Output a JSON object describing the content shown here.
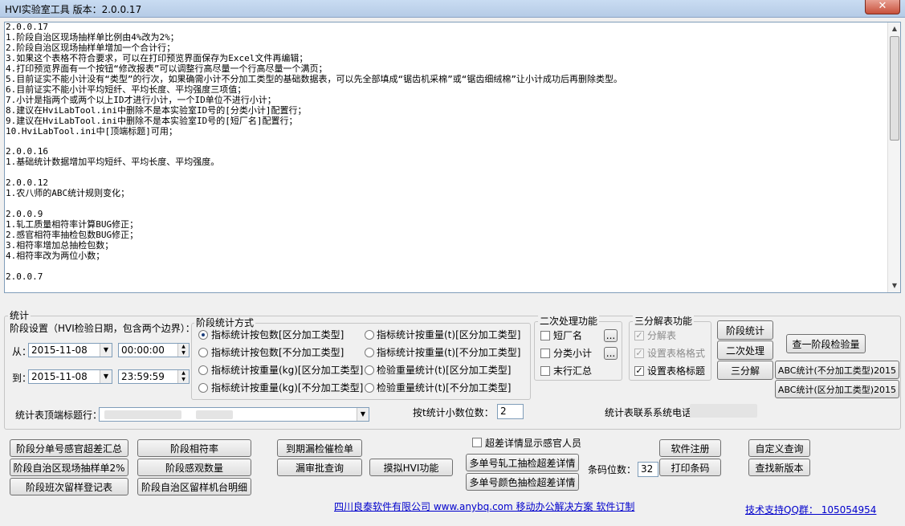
{
  "window": {
    "title": "HVI实验室工具 版本：2.0.0.17",
    "close_label": "✕"
  },
  "changelog": [
    "2.0.0.17",
    "1.阶段自治区现场抽样单比例由4%改为2%；",
    "2.阶段自治区现场抽样单增加一个合计行；",
    "3.如果这个表格不符合要求，可以在打印预览界面保存为Excel文件再编辑；",
    "4.打印预览界面有一个按钮“修改报表”可以调整行高尽量一个行高尽量一个满页；",
    "5.目前证实不能小计没有“类型”的行次，如果确需小计不分加工类型的基础数据表，可以先全部填成“锯齿机采棉”或“锯齿细绒棉”让小计成功后再删除类型。",
    "6.目前证实不能小计平均短纤、平均长度、平均强度三项值；",
    "7.小计是指两个或两个以上ID才进行小计，一个ID单位不进行小计；",
    "8.建议在HviLabTool.ini中删除不是本实验室ID号的[分类小计]配置行；",
    "9.建议在HviLabTool.ini中删除不是本实验室ID号的[短厂名]配置行；",
    "10.HviLabTool.ini中[顶端标题]可用；",
    "",
    "2.0.0.16",
    "1.基础统计数据增加平均短纤、平均长度、平均强度。",
    "",
    "2.0.0.12",
    "1.农八师的ABC统计规则变化；",
    "",
    "2.0.0.9",
    "1.轧工质量相符率计算BUG修正；",
    "2.感官相符率抽检包数BUG修正；",
    "3.相符率增加总抽检包数；",
    "4.相符率改为两位小数；",
    "",
    "2.0.0.7"
  ],
  "stats": {
    "group_label": "统计",
    "period_label": "阶段设置（HVI检验日期，包含两个边界）：",
    "from_label": "从：",
    "to_label": "到：",
    "from_date": "2015-11-08",
    "from_time": "00:00:00",
    "to_date": "2015-11-08",
    "to_time": "23:59:59",
    "method": {
      "label": "阶段统计方式",
      "options": [
        "指标统计按包数[区分加工类型]",
        "指标统计按包数[不分加工类型]",
        "指标统计按重量(kg)[区分加工类型]",
        "指标统计按重量(kg)[不分加工类型]",
        "指标统计按重量(t)[区分加工类型]",
        "指标统计按重量(t)[不分加工类型]",
        "检验重量统计(t)[区分加工类型]",
        "检验重量统计(t)[不分加工类型]"
      ]
    },
    "secondary": {
      "label": "二次处理功能",
      "items": [
        "短厂名",
        "分类小计",
        "末行汇总"
      ],
      "browse": "..."
    },
    "tri": {
      "label": "三分解表功能",
      "items": [
        "分解表",
        "设置表格格式",
        "设置表格标题"
      ]
    },
    "buttons": {
      "period_stats": "阶段统计",
      "secondary": "二次处理",
      "tri": "三分解",
      "query_inspect": "查一阶段检验量",
      "abc_no_split": "ABC统计(不分加工类型)2015",
      "abc_split": "ABC统计(区分加工类型)2015"
    },
    "header_row_label": "统计表顶端标题行：",
    "decimal_label": "按t统计小数位数：",
    "decimal_value": "2",
    "phone_label": "统计表联系系统电话："
  },
  "actions": {
    "col1": [
      "阶段分单号感官超差汇总",
      "阶段自治区现场抽样单2%",
      "阶段班次留样登记表"
    ],
    "col2": [
      "阶段相符率",
      "阶段感观数量",
      "阶段自治区留样机台明细"
    ],
    "col3": [
      "到期漏检催检单",
      "漏审批查询"
    ],
    "mock_hvi": "摸拟HVI功能",
    "over_detail_label": "超差详情显示感官人员",
    "multi_rolling": "多单号轧工抽检超差详情",
    "multi_color": "多单号颜色抽检超差详情",
    "barcode_label": "条码位数：",
    "barcode_value": "32",
    "register": "软件注册",
    "print_barcode": "打印条码",
    "custom_query": "自定义查询",
    "new_version": "查找新版本"
  },
  "footer": {
    "company": "四川良泰软件有限公司  www.anybq.com  移动办公解决方案  软件订制",
    "support": "技术支持QQ群：  105054954"
  }
}
